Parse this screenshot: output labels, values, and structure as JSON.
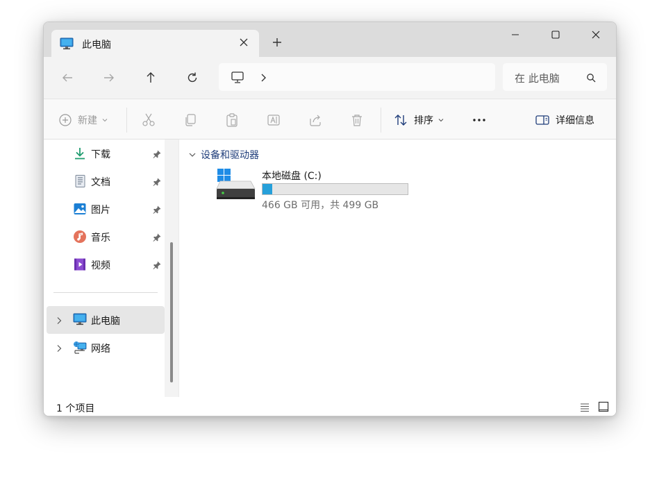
{
  "tab": {
    "title": "此电脑",
    "icon": "computer-monitor-icon"
  },
  "window_controls": {
    "minimize": "minimize-icon",
    "maximize": "maximize-icon",
    "close": "close-icon"
  },
  "address": {
    "location_icon": "pc-outline-icon",
    "search_placeholder": "在 此电脑"
  },
  "commands": {
    "new_label": "新建",
    "sort_label": "排序",
    "details_label": "详细信息"
  },
  "sidebar": {
    "quick_access": [
      {
        "label": "下载",
        "icon": "download-icon",
        "pinned": true
      },
      {
        "label": "文档",
        "icon": "document-icon",
        "pinned": true
      },
      {
        "label": "图片",
        "icon": "pictures-icon",
        "pinned": true
      },
      {
        "label": "音乐",
        "icon": "music-icon",
        "pinned": true
      },
      {
        "label": "视频",
        "icon": "video-icon",
        "pinned": true
      }
    ],
    "locations": [
      {
        "label": "此电脑",
        "icon": "computer-monitor-icon",
        "selected": true
      },
      {
        "label": "网络",
        "icon": "network-icon",
        "selected": false
      }
    ]
  },
  "content": {
    "group_label": "设备和驱动器",
    "drives": [
      {
        "name": "本地磁盘 (C:)",
        "free_text": "466 GB 可用，共 499 GB",
        "used_fraction": 0.066,
        "bar_color": "#26a0da"
      }
    ]
  },
  "status": {
    "item_count": "1 个项目"
  },
  "colors": {
    "accent": "#0067c0",
    "title_bar": "#dcdcdc",
    "selection": "#e6e6e6",
    "drive_bar": "#26a0da"
  }
}
